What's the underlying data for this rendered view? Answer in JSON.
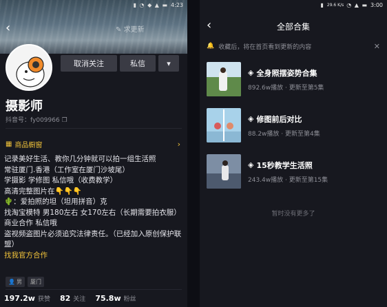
{
  "left": {
    "status": {
      "time": "4:23",
      "net": ""
    },
    "follow_hint": "求更新",
    "buttons": {
      "unfollow": "取消关注",
      "message": "私信",
      "more": "▾"
    },
    "name": "摄影师",
    "uid": "抖音号：fy009966",
    "shop_label": "商品橱窗",
    "bio": [
      "记录美好生活、教你几分钟就可以拍一组生活照",
      "常驻厦门.香港（工作室在厦门沙坡尾）",
      "学摄影 学修图 私信哦（收费教学）",
      "高清完整图片在👇👇👇",
      "🌵：爱拍照的坦（坦用拼音）克",
      "找淘宝模特 男180左右 女170左右（长期需要拍衣服）",
      "商业合作 私信哦",
      "盗视频盗图片必须追究法律责任。（已经加入原创保护联盟）"
    ],
    "bio_link": "找我官方合作",
    "tags": [
      {
        "icon": "male-icon",
        "label": "男"
      },
      {
        "label": "厦门"
      }
    ],
    "stats": [
      {
        "num": "197.2w",
        "label": "获赞"
      },
      {
        "num": "82",
        "label": "关注"
      },
      {
        "num": "75.8w",
        "label": "粉丝"
      }
    ]
  },
  "right": {
    "status": {
      "time": "3:00",
      "net": "29.6 K/s"
    },
    "title": "全部合集",
    "notice": "收藏后，将在首页看到更新的内容",
    "collections": [
      {
        "title": "全身照摆姿势合集",
        "meta": "892.6w播放 · 更新至第5集"
      },
      {
        "title": "修图前后对比",
        "meta": "88.2w播放 · 更新至第4集"
      },
      {
        "title": "15秒教学生活照",
        "meta": "243.4w播放 · 更新至第15集"
      }
    ],
    "no_more": "暂时没有更多了"
  }
}
